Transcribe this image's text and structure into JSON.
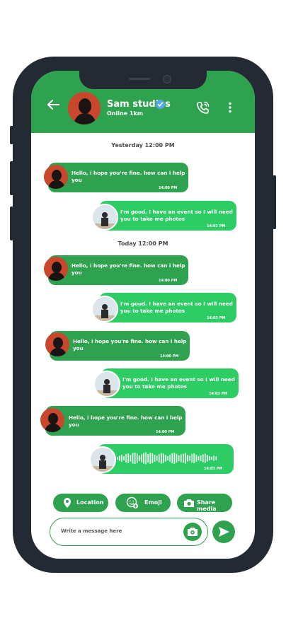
{
  "header": {
    "name": "Sam studios",
    "status": "Online   1km",
    "accent": "#2fa24f"
  },
  "days": [
    "Yesterday 12:00 PM",
    "Today 12:00 PM"
  ],
  "messages": [
    {
      "side": "incoming",
      "line1": "Hello, i hope you're fine. how can i help",
      "line2": "you",
      "time": "14:00 PM"
    },
    {
      "side": "outgoing",
      "line1": "I'm good. I have an event so I will need",
      "line2": "you to take me photos",
      "time": "14:03 PM"
    },
    {
      "side": "incoming",
      "line1": "Hello, i hope you're fine. how can i help",
      "line2": "you",
      "time": "14:00 PM"
    },
    {
      "side": "outgoing",
      "line1": "I'm good. I have an event so I will need",
      "line2": "you to take me photos",
      "time": "14:03 PM"
    },
    {
      "side": "incoming",
      "line1": "Hello, i hope you're fine. how can i help",
      "line2": "you",
      "time": "14:00 PM"
    },
    {
      "side": "outgoing",
      "line1": "I'm good. I have an event so I will need",
      "line2": "you to take me photos",
      "time": "14:03 PM"
    },
    {
      "side": "incoming",
      "line1": "Hello, i hope you're fine. how can i help",
      "line2": "you",
      "time": "14:00 PM"
    },
    {
      "side": "outgoing-voice",
      "time": "14:03 PM"
    }
  ],
  "actions": {
    "location": "Location",
    "emoji": "Emoji",
    "share": "Share media"
  },
  "composer": {
    "placeholder": "Write a message here"
  },
  "icons": [
    "back-arrow-icon",
    "verified-icon",
    "phone-call-icon",
    "more-vert-icon",
    "location-pin-icon",
    "emoji-add-icon",
    "camera-icon",
    "send-icon"
  ]
}
